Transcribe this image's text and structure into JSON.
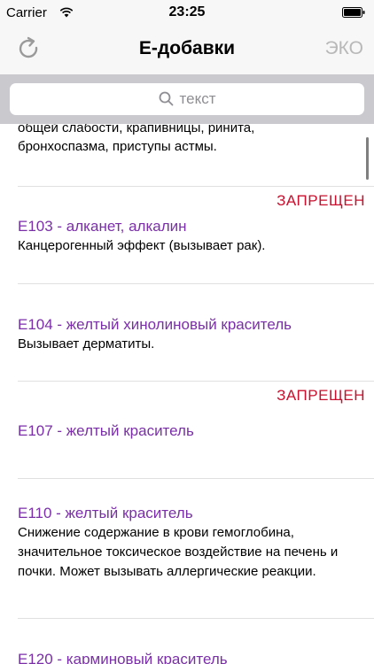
{
  "status": {
    "carrier": "Carrier",
    "time": "23:25"
  },
  "nav": {
    "title": "Е-добавки",
    "eco_label": "ЭКО"
  },
  "search": {
    "placeholder": "текст"
  },
  "partial": {
    "line1": "общей слабости, крапивницы, ринита,",
    "line2": "бронхоспазма, приступы астмы."
  },
  "items": [
    {
      "banned": "ЗАПРЕЩЕН",
      "name": "E103 - алканет, алкалин",
      "desc": "Канцерогенный эффект (вызывает рак)."
    },
    {
      "banned": "",
      "name": "E104 - желтый хинолиновый краситель",
      "desc": "Вызывает дерматиты."
    },
    {
      "banned": "ЗАПРЕЩЕН",
      "name": "E107 - желтый краситель",
      "desc": ""
    },
    {
      "banned": "",
      "name": "E110 - желтый краситель",
      "desc": "Снижение содержание в крови гемоглобина, значительное токсическое воздействие на печень и почки. Может вызывать аллергические реакции."
    },
    {
      "banned": "",
      "name": "E120 - карминовый краситель",
      "desc": ""
    }
  ]
}
